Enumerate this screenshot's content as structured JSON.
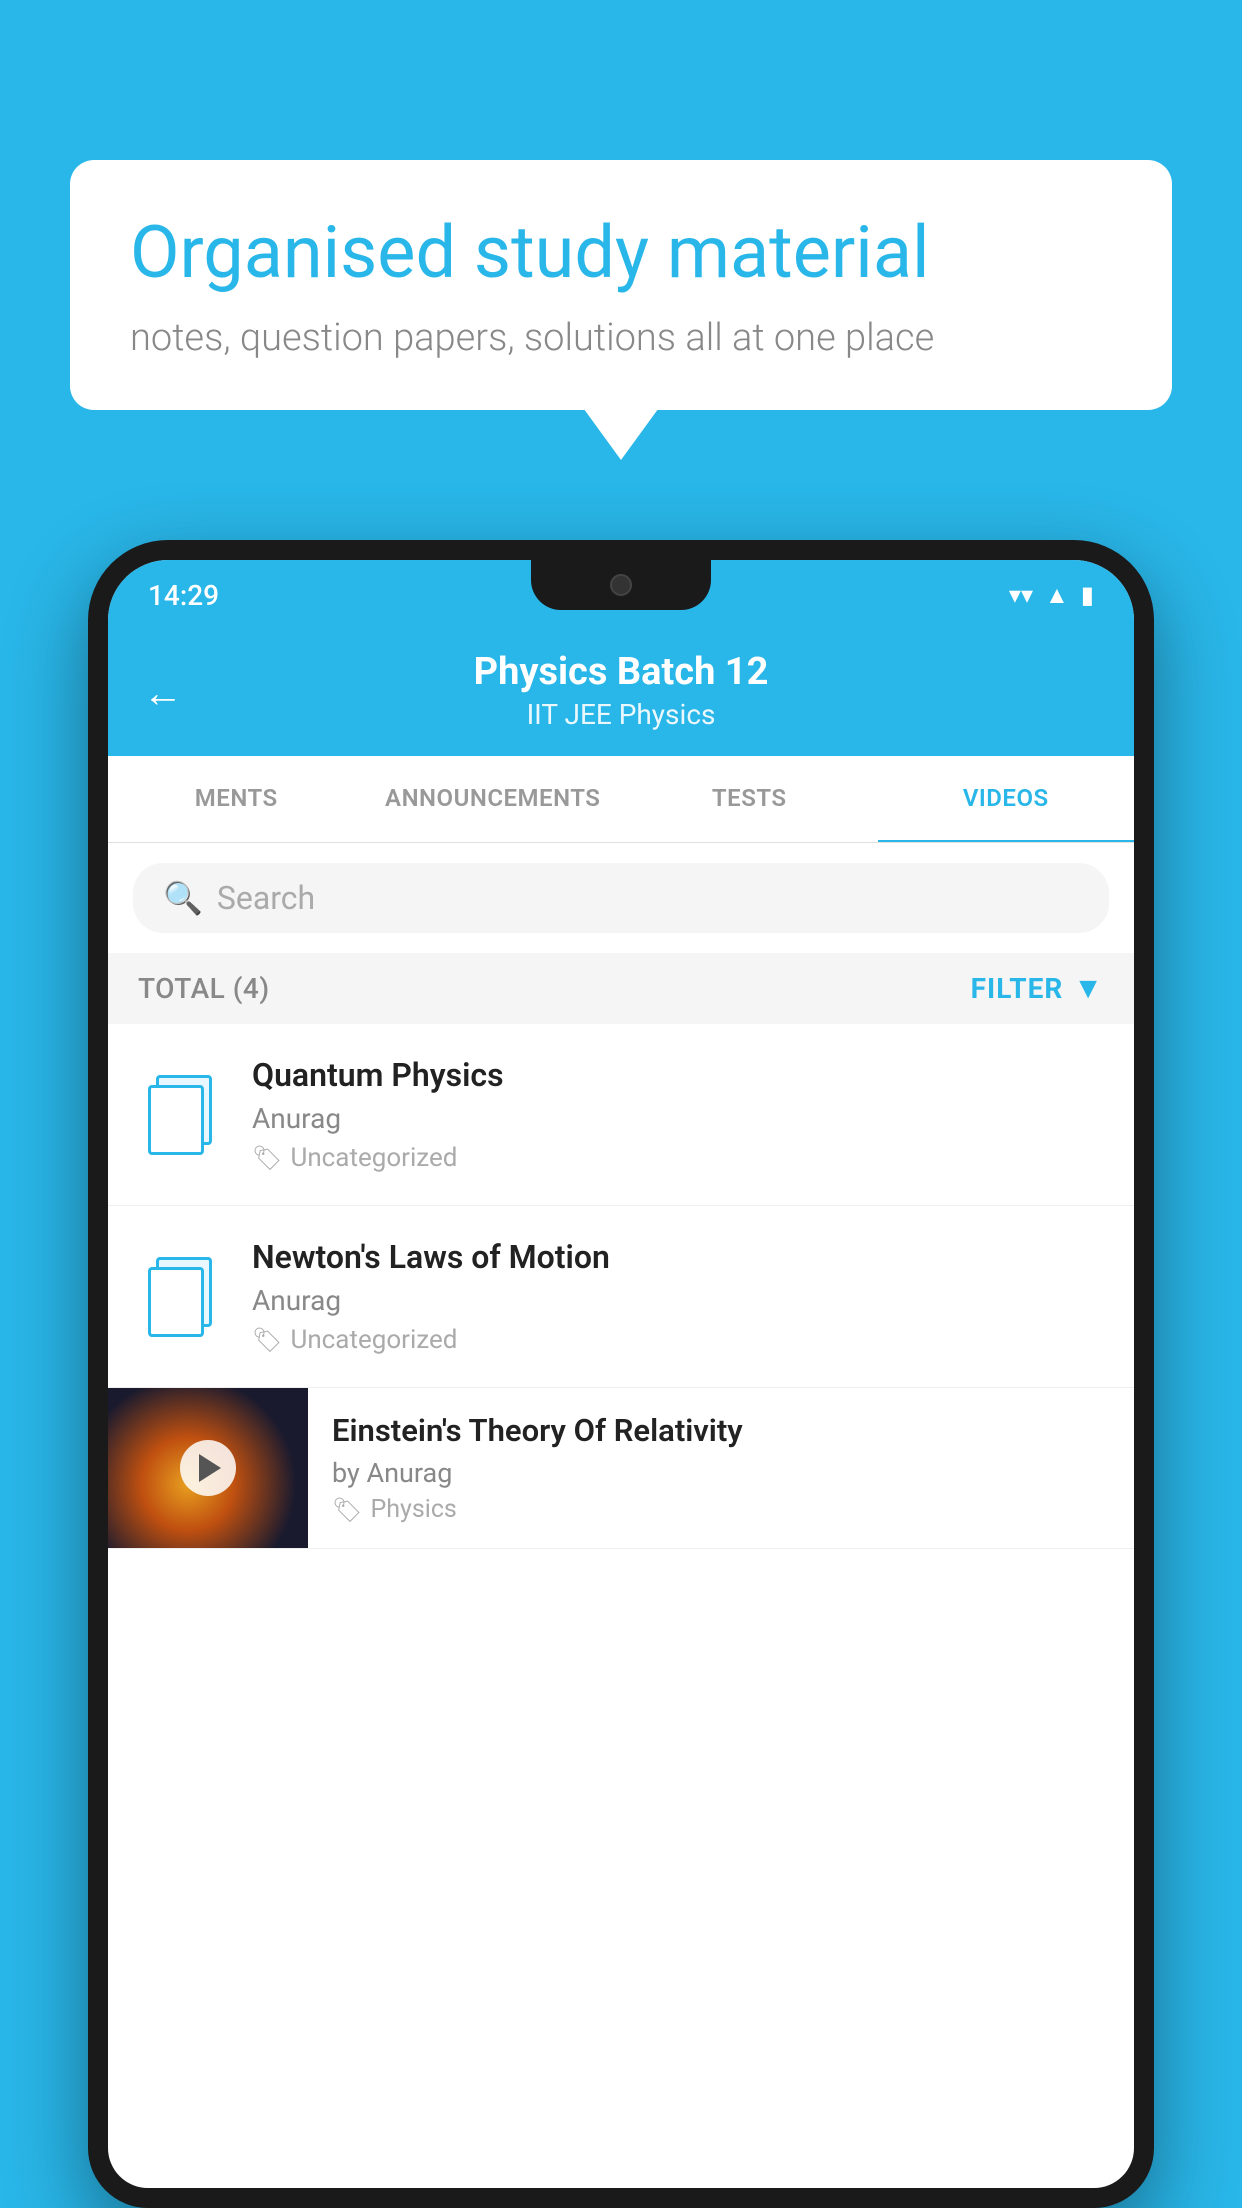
{
  "background_color": "#29b6e8",
  "speech_bubble": {
    "headline": "Organised study material",
    "subtext": "notes, question papers, solutions all at one place"
  },
  "status_bar": {
    "time": "14:29",
    "wifi_icon": "▼",
    "signal_icon": "▲",
    "battery_icon": "▮"
  },
  "app_header": {
    "back_label": "←",
    "title": "Physics Batch 12",
    "subtitle": "IIT JEE   Physics"
  },
  "tabs": [
    {
      "label": "MENTS",
      "active": false
    },
    {
      "label": "ANNOUNCEMENTS",
      "active": false
    },
    {
      "label": "TESTS",
      "active": false
    },
    {
      "label": "VIDEOS",
      "active": true
    }
  ],
  "search": {
    "placeholder": "Search"
  },
  "filter_bar": {
    "total_label": "TOTAL (4)",
    "filter_label": "FILTER"
  },
  "videos": [
    {
      "title": "Quantum Physics",
      "author": "Anurag",
      "tag": "Uncategorized",
      "has_thumbnail": false
    },
    {
      "title": "Newton's Laws of Motion",
      "author": "Anurag",
      "tag": "Uncategorized",
      "has_thumbnail": false
    },
    {
      "title": "Einstein's Theory Of Relativity",
      "author": "by Anurag",
      "tag": "Physics",
      "has_thumbnail": true
    }
  ]
}
